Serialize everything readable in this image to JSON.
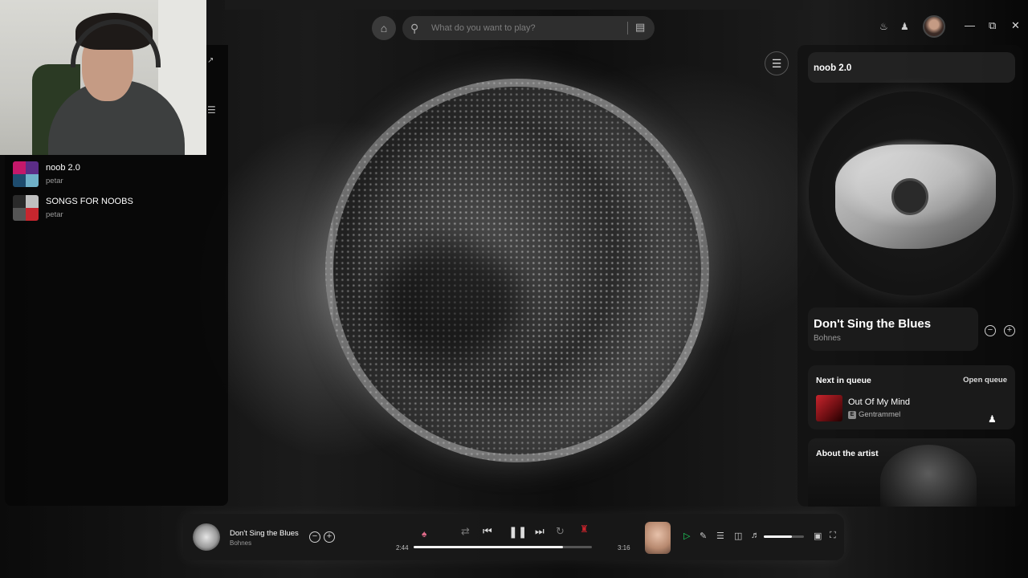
{
  "topbar": {
    "search_placeholder": "What do you want to play?"
  },
  "library": {
    "items": [
      {
        "title": "noob 2.0",
        "owner": "petar"
      },
      {
        "title": "SONGS FOR NOOBS",
        "owner": "petar"
      }
    ]
  },
  "right_panel": {
    "header": "noob 2.0",
    "now_playing": {
      "title": "Don't Sing the Blues",
      "artist": "Bohnes"
    },
    "queue": {
      "heading": "Next in queue",
      "open_label": "Open queue",
      "track": {
        "title": "Out Of My Mind",
        "explicit_badge": "E",
        "artist": "Gentrammel"
      }
    },
    "about": {
      "heading": "About the artist"
    }
  },
  "player": {
    "title": "Don't Sing the Blues",
    "artist": "Bohnes",
    "elapsed": "2:44",
    "duration": "3:16",
    "progress_fraction": 0.84,
    "volume_fraction": 0.7,
    "accent_color": "#1ed760"
  },
  "icons": {
    "home": "home-icon",
    "search": "search-icon",
    "browse": "browse-icon",
    "bell": "bell-icon",
    "friends": "friends-icon",
    "shuffle": "shuffle-icon",
    "previous": "skip-previous-icon",
    "pause": "pause-icon",
    "next": "skip-next-icon",
    "repeat": "repeat-icon"
  }
}
